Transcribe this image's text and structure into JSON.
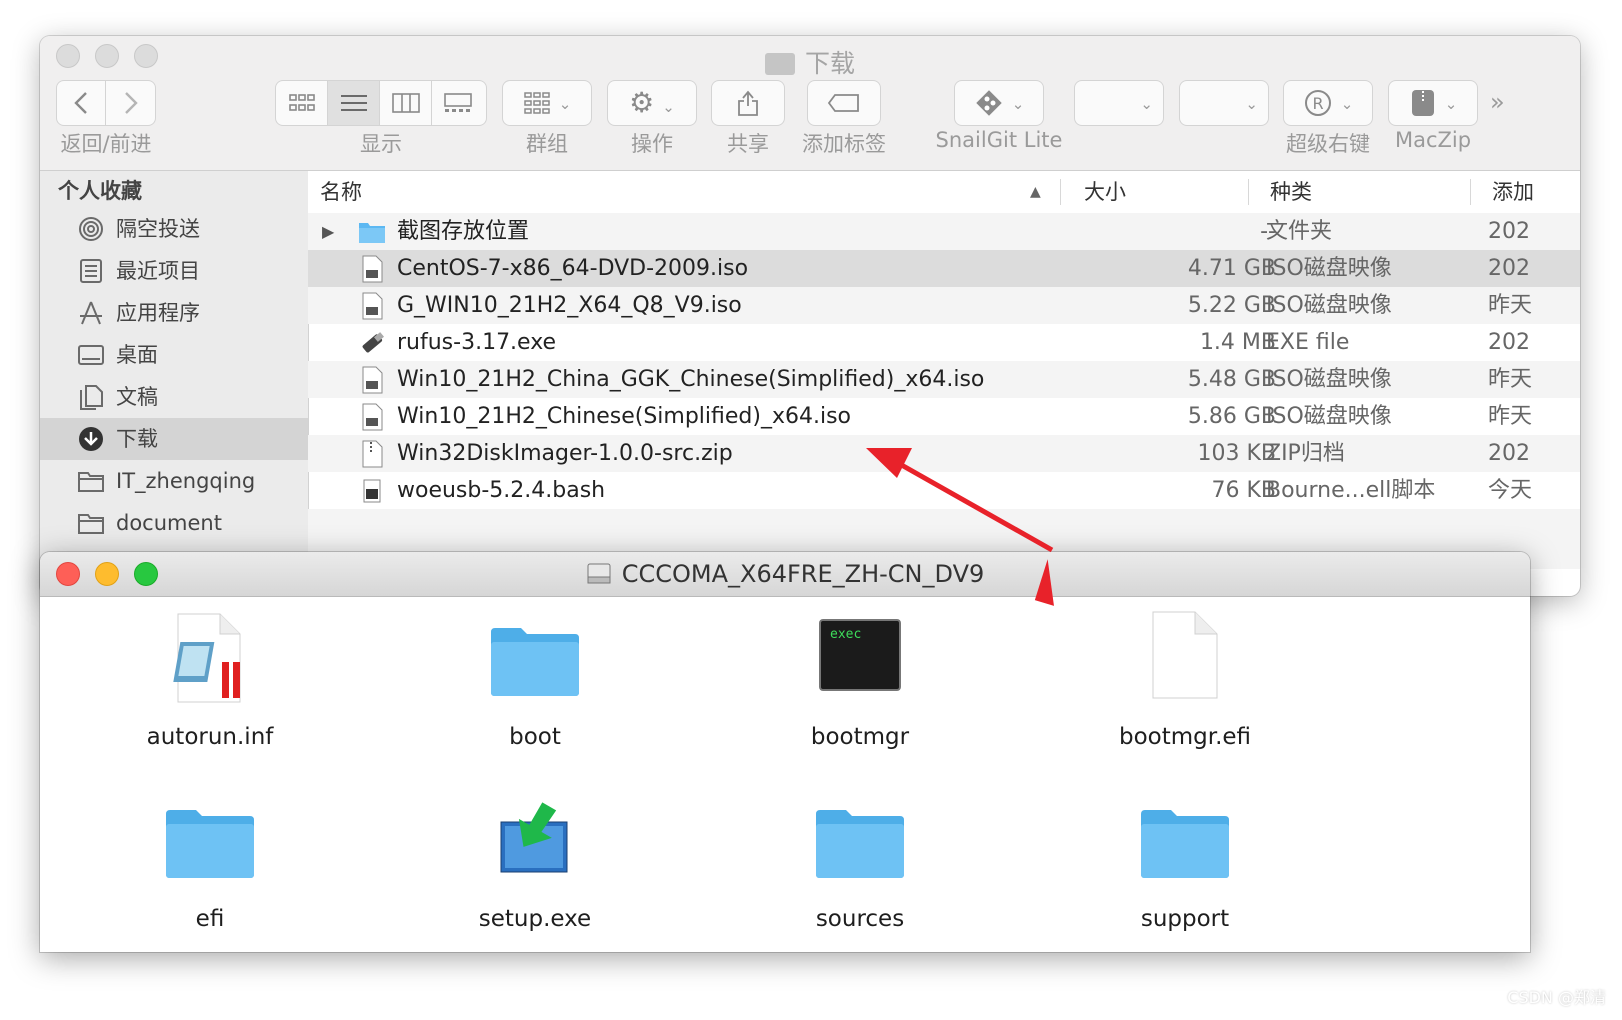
{
  "back_window": {
    "title": "下载",
    "toolbar": {
      "nav_label": "返回/前进",
      "view_label": "显示",
      "group_label": "群组",
      "action_label": "操作",
      "share_label": "共享",
      "tag_label": "添加标签",
      "snailgit_label": "SnailGit Lite",
      "rightclick_label": "超级右键",
      "maczip_label": "MacZip",
      "overflow": "»"
    },
    "sidebar": {
      "heading": "个人收藏",
      "items": [
        {
          "label": "隔空投送",
          "icon": "airdrop-icon"
        },
        {
          "label": "最近项目",
          "icon": "recents-icon"
        },
        {
          "label": "应用程序",
          "icon": "applications-icon"
        },
        {
          "label": "桌面",
          "icon": "desktop-icon"
        },
        {
          "label": "文稿",
          "icon": "documents-icon"
        },
        {
          "label": "下载",
          "icon": "downloads-icon",
          "selected": true
        },
        {
          "label": "IT_zhengqing",
          "icon": "folder-icon"
        },
        {
          "label": "document",
          "icon": "folder-icon"
        }
      ]
    },
    "columns": {
      "name": "名称",
      "size": "大小",
      "kind": "种类",
      "date": "添加"
    },
    "files": [
      {
        "name": "截图存放位置",
        "size": "--",
        "kind": "文件夹",
        "date": "202",
        "type": "folder"
      },
      {
        "name": "CentOS-7-x86_64-DVD-2009.iso",
        "size": "4.71 GB",
        "kind": "ISO磁盘映像",
        "date": "202",
        "type": "iso",
        "selected": true
      },
      {
        "name": "G_WIN10_21H2_X64_Q8_V9.iso",
        "size": "5.22 GB",
        "kind": "ISO磁盘映像",
        "date": "昨天",
        "type": "iso"
      },
      {
        "name": "rufus-3.17.exe",
        "size": "1.4 MB",
        "kind": "EXE file",
        "date": "202",
        "type": "usb"
      },
      {
        "name": "Win10_21H2_China_GGK_Chinese(Simplified)_x64.iso",
        "size": "5.48 GB",
        "kind": "ISO磁盘映像",
        "date": "昨天",
        "type": "iso"
      },
      {
        "name": "Win10_21H2_Chinese(Simplified)_x64.iso",
        "size": "5.86 GB",
        "kind": "ISO磁盘映像",
        "date": "昨天",
        "type": "iso"
      },
      {
        "name": "Win32DiskImager-1.0.0-src.zip",
        "size": "103 KB",
        "kind": "ZIP归档",
        "date": "202",
        "type": "zip"
      },
      {
        "name": "woeusb-5.2.4.bash",
        "size": "76 KB",
        "kind": "Bourne...ell脚本",
        "date": "今天",
        "type": "script"
      }
    ]
  },
  "front_window": {
    "title": "CCCOMA_X64FRE_ZH-CN_DV9",
    "items": [
      {
        "label": "autorun.inf",
        "icon": "inf-file-icon"
      },
      {
        "label": "boot",
        "icon": "folder-icon"
      },
      {
        "label": "bootmgr",
        "icon": "exec-icon",
        "icon_text": "exec"
      },
      {
        "label": "bootmgr.efi",
        "icon": "blank-file-icon"
      },
      {
        "label": "efi",
        "icon": "folder-icon"
      },
      {
        "label": "setup.exe",
        "icon": "setup-icon"
      },
      {
        "label": "sources",
        "icon": "folder-icon"
      },
      {
        "label": "support",
        "icon": "folder-icon"
      }
    ]
  },
  "colors": {
    "annotation_arrow": "#e8222a",
    "folder_blue": "#5cb8f2",
    "close": "#fe5f57",
    "minimize": "#febc2e",
    "zoom": "#28c840"
  },
  "watermark": "CSDN @郑清"
}
